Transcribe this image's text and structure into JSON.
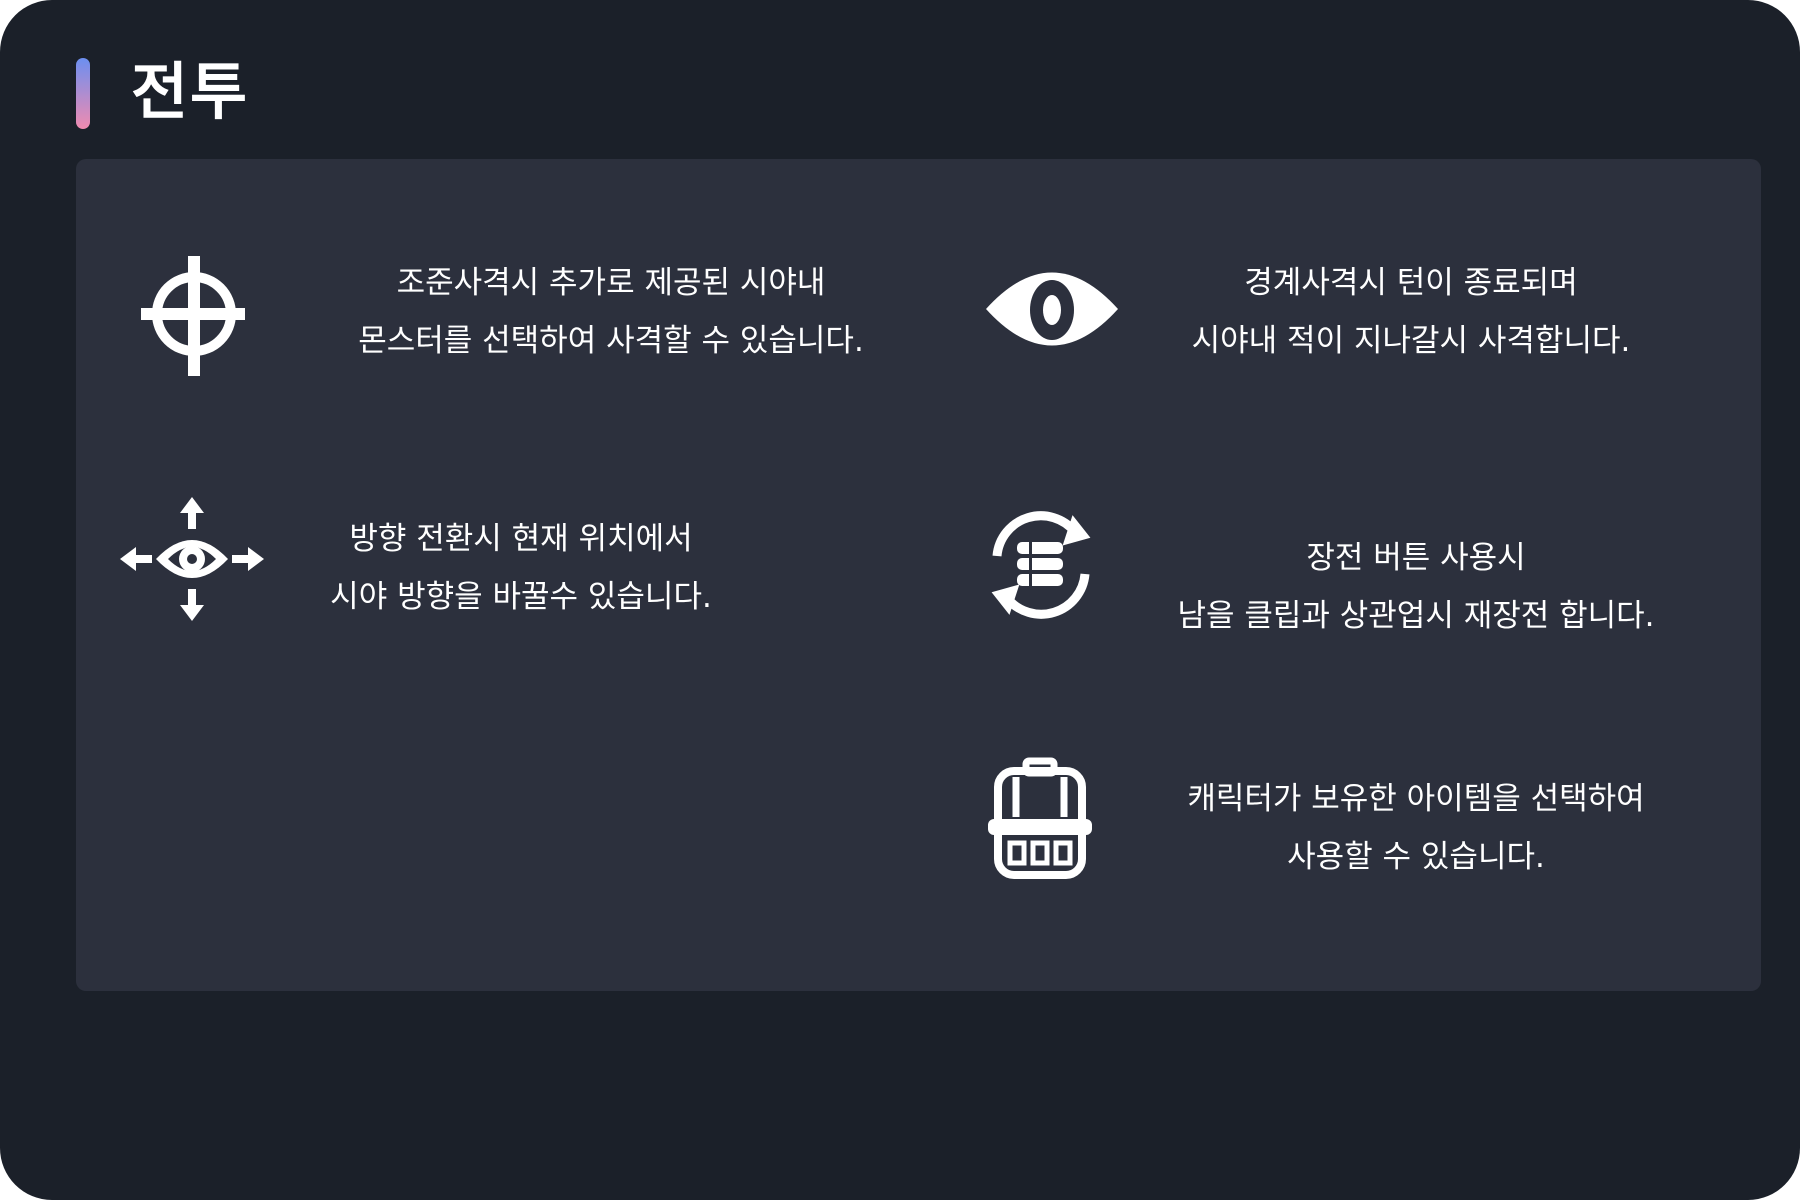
{
  "header": {
    "title": "전투",
    "accent_gradient": [
      "#6c8ff0",
      "#f08bb0"
    ]
  },
  "colors": {
    "window_bg": "#1b2029",
    "panel_bg": "#2c303d",
    "text": "#ffffff"
  },
  "features": [
    {
      "icon": "crosshair-icon",
      "lines": [
        "조준사격시 추가로 제공된 시야내",
        "몬스터를 선택하여 사격할 수 있습니다."
      ]
    },
    {
      "icon": "eye-icon",
      "lines": [
        "경계사격시 턴이 종료되며",
        "시야내 적이 지나갈시 사격합니다."
      ]
    },
    {
      "icon": "eye-arrows-icon",
      "lines": [
        "방향 전환시 현재 위치에서",
        "시야 방향을 바꿀수 있습니다."
      ]
    },
    {
      "icon": "reload-icon",
      "lines": [
        "장전 버튼 사용시",
        "남을 클립과 상관업시 재장전 합니다."
      ]
    },
    {
      "icon": "backpack-icon",
      "lines": [
        "캐릭터가 보유한 아이템을 선택하여",
        "사용할 수 있습니다."
      ]
    }
  ]
}
